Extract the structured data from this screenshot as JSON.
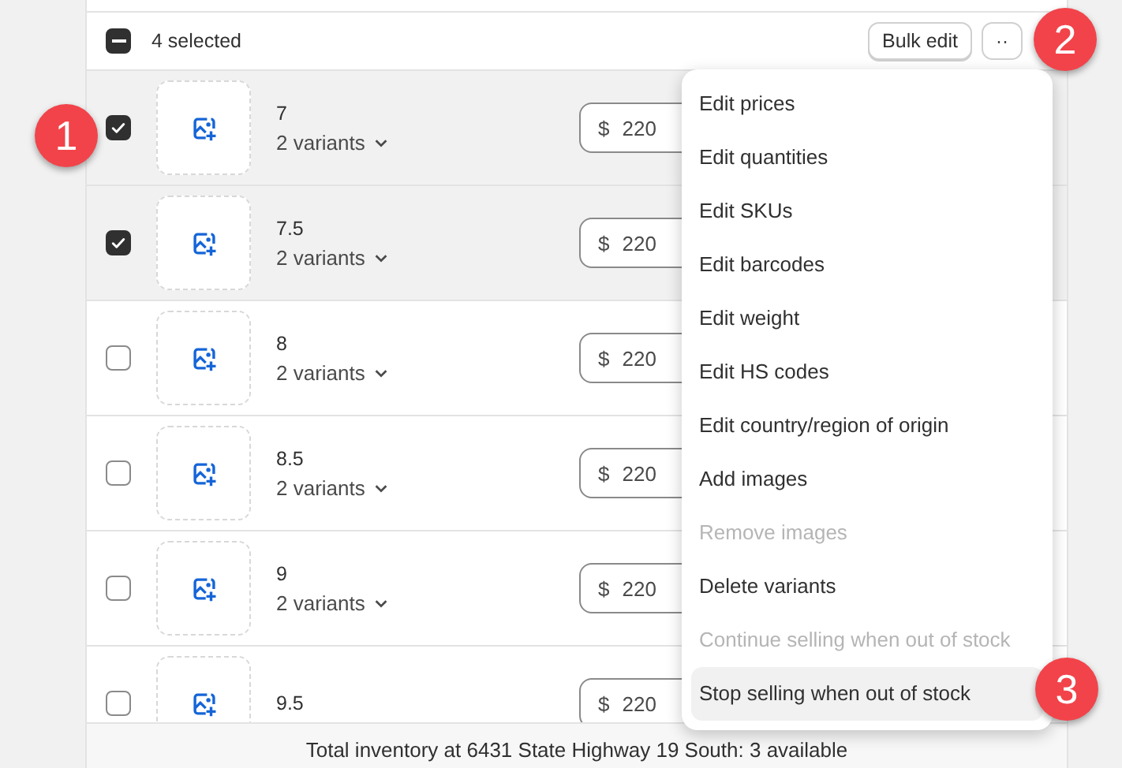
{
  "header": {
    "select_all_partial": true,
    "selection_label": "4 selected",
    "bulk_edit": "Bulk edit",
    "more_button": "··"
  },
  "rows": [
    {
      "title": "7",
      "variants": "2 variants",
      "currency": "$",
      "price": "220",
      "checked": true,
      "selected": true
    },
    {
      "title": "7.5",
      "variants": "2 variants",
      "currency": "$",
      "price": "220",
      "checked": true,
      "selected": true
    },
    {
      "title": "8",
      "variants": "2 variants",
      "currency": "$",
      "price": "220",
      "checked": false,
      "selected": false
    },
    {
      "title": "8.5",
      "variants": "2 variants",
      "currency": "$",
      "price": "220",
      "checked": false,
      "selected": false
    },
    {
      "title": "9",
      "variants": "2 variants",
      "currency": "$",
      "price": "220",
      "checked": false,
      "selected": false
    },
    {
      "title": "9.5",
      "currency": "$",
      "price": "220",
      "checked": false,
      "selected": false
    }
  ],
  "footer": "Total inventory at 6431 State Highway 19 South: 3 available",
  "menu": [
    {
      "label": "Edit prices",
      "disabled": false,
      "selected": false
    },
    {
      "label": "Edit quantities",
      "disabled": false,
      "selected": false
    },
    {
      "label": "Edit SKUs",
      "disabled": false,
      "selected": false
    },
    {
      "label": "Edit barcodes",
      "disabled": false,
      "selected": false
    },
    {
      "label": "Edit weight",
      "disabled": false,
      "selected": false
    },
    {
      "label": "Edit HS codes",
      "disabled": false,
      "selected": false
    },
    {
      "label": "Edit country/region of origin",
      "disabled": false,
      "selected": false
    },
    {
      "label": "Add images",
      "disabled": false,
      "selected": false
    },
    {
      "label": "Remove images",
      "disabled": true,
      "selected": false
    },
    {
      "label": "Delete variants",
      "disabled": false,
      "selected": false
    },
    {
      "label": "Continue selling when out of stock",
      "disabled": true,
      "selected": false
    },
    {
      "label": "Stop selling when out of stock",
      "disabled": false,
      "selected": true
    }
  ],
  "callouts": [
    "1",
    "2",
    "3"
  ]
}
